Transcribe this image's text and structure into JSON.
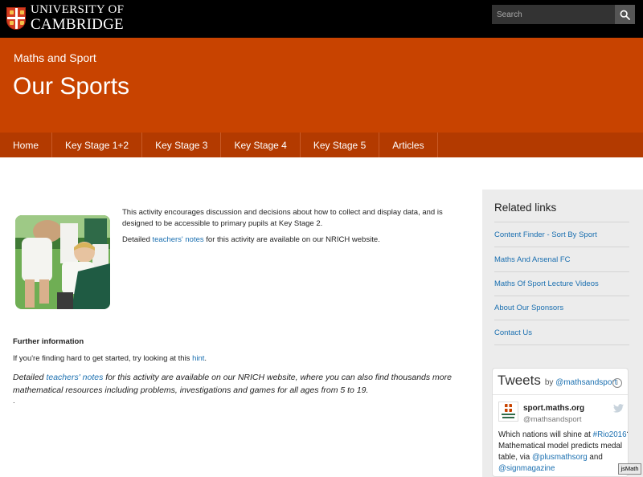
{
  "header": {
    "logo_line1": "UNIVERSITY OF",
    "logo_line2": "CAMBRIDGE",
    "search_placeholder": "Search"
  },
  "banner": {
    "subtitle": "Maths and Sport",
    "title": "Our Sports"
  },
  "nav": {
    "items": [
      "Home",
      "Key Stage 1+2",
      "Key Stage 3",
      "Key Stage 4",
      "Key Stage 5",
      "Articles"
    ]
  },
  "main": {
    "intro_p1": "This activity encourages discussion and decisions about how to collect and display data, and is designed to be accessible to primary pupils at Key Stage 2.",
    "intro_p2_before": "Detailed ",
    "intro_p2_link": "teachers' notes",
    "intro_p2_after": " for this activity are available on our NRICH website.",
    "further_heading": "Further information",
    "hint_before": "If you're finding hard to get started, try looking at this ",
    "hint_link": "hint",
    "hint_after": ".",
    "detail_before": "Detailed ",
    "detail_link": "teachers' notes",
    "detail_after": " for this activity are available on our NRICH website, where you can also find thousands more mathematical resources including problems, investigations and games for all ages from 5 to 19.",
    "dot": "."
  },
  "sidebar": {
    "heading": "Related links",
    "links": [
      "Content Finder - Sort By Sport",
      "Maths And Arsenal FC",
      "Maths Of Sport Lecture Videos",
      "About Our Sponsors",
      "Contact Us"
    ]
  },
  "tweets": {
    "title": "Tweets",
    "by": "by",
    "by_handle": "@mathsandsport",
    "user_name": "sport.maths.org",
    "user_handle": "@mathsandsport",
    "text_1": "Which nations will shine at ",
    "hashtag": "#Rio2016",
    "text_2": "? Mathematical model predicts medal table, via ",
    "mention_1": "@plusmathsorg",
    "text_3": " and ",
    "mention_2": "@signmagazine"
  },
  "badge": "jsMath",
  "colors": {
    "topbar": "#000000",
    "banner": "#c84300",
    "nav": "#b33a00",
    "link": "#1a6fb0",
    "sidebar": "#ececec"
  }
}
